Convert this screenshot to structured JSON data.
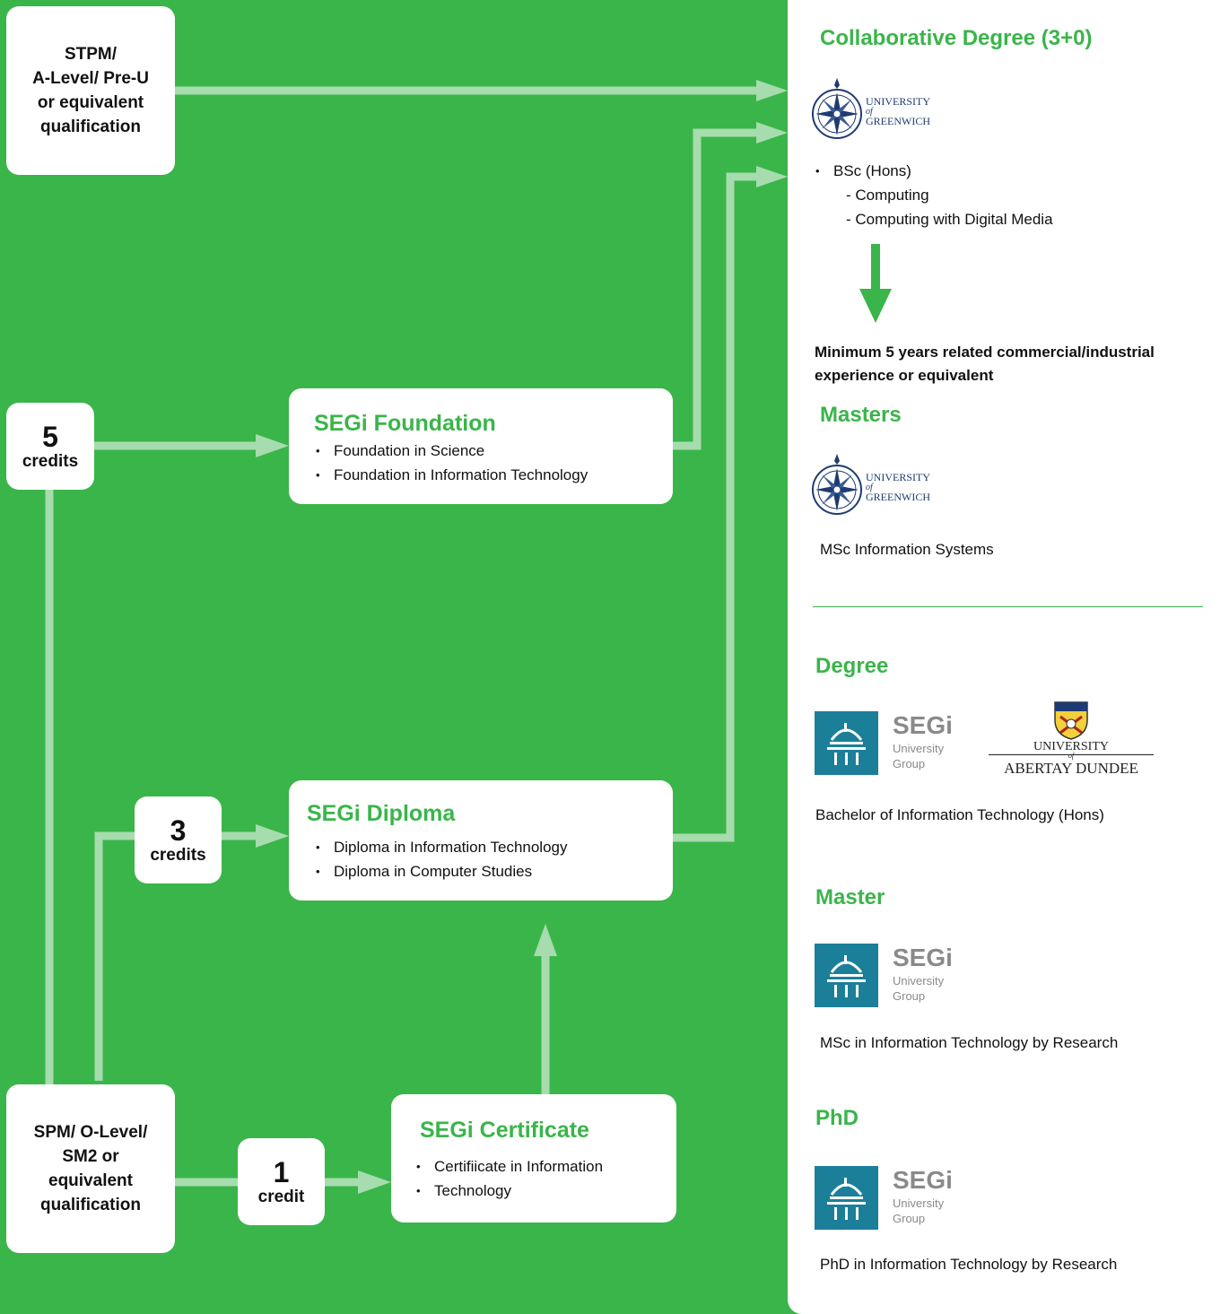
{
  "entry_boxes": {
    "stpm": [
      "STPM/",
      "A-Level/ Pre-U",
      "or equivalent",
      "qualification"
    ],
    "spm": [
      "SPM/ O-Level/",
      "SM2 or",
      "equivalent",
      "qualification"
    ]
  },
  "credit_boxes": {
    "five": {
      "number": "5",
      "label": "credits"
    },
    "three": {
      "number": "3",
      "label": "credits"
    },
    "one": {
      "number": "1",
      "label": "credit"
    }
  },
  "programmes": {
    "foundation": {
      "title": "SEGi Foundation",
      "items": [
        "Foundation in Science",
        "Foundation in Information Technology"
      ]
    },
    "diploma": {
      "title": "SEGi Diploma",
      "items": [
        "Diploma in Information Technology",
        "Diploma in Computer Studies"
      ]
    },
    "certificate": {
      "title": "SEGi Certificate",
      "items": [
        "Certifiicate in Information",
        "Technology"
      ]
    }
  },
  "right_panel": {
    "collaborative": {
      "heading": "Collaborative Degree (3+0)",
      "logo": {
        "line1": "UNIVERSITY",
        "line2": "of",
        "line3": "GREENWICH",
        "icon": "compass-rose-icon"
      },
      "bullet": "BSc (Hons)",
      "subitems": [
        "- Computing",
        "- Computing with Digital Media"
      ]
    },
    "requirement": "Minimum 5 years related commercial/industrial experience or equivalent",
    "masters": {
      "heading": "Masters",
      "logo": {
        "line1": "UNIVERSITY",
        "line2": "of",
        "line3": "GREENWICH"
      },
      "text": "MSc Information Systems"
    },
    "degree": {
      "heading": "Degree",
      "segi_logo": {
        "name": "SEGi",
        "line1": "University",
        "line2": "Group"
      },
      "abertay_logo": {
        "line1": "UNIVERSITY",
        "line2": "of",
        "line3": "ABERTAY DUNDEE"
      },
      "text": "Bachelor of Information Technology (Hons)"
    },
    "master": {
      "heading": "Master",
      "segi_logo": {
        "name": "SEGi",
        "line1": "University",
        "line2": "Group"
      },
      "text": "MSc in Information Technology by Research"
    },
    "phd": {
      "heading": "PhD",
      "segi_logo": {
        "name": "SEGi",
        "line1": "University",
        "line2": "Group"
      },
      "text": "PhD in Information Technology by Research"
    }
  },
  "colors": {
    "background": "#3ab54a",
    "connector": "#a6dcae",
    "accent_green": "#3ab54a",
    "segi_teal": "#1b7f9a",
    "greenwich_navy": "#1f3b73"
  }
}
